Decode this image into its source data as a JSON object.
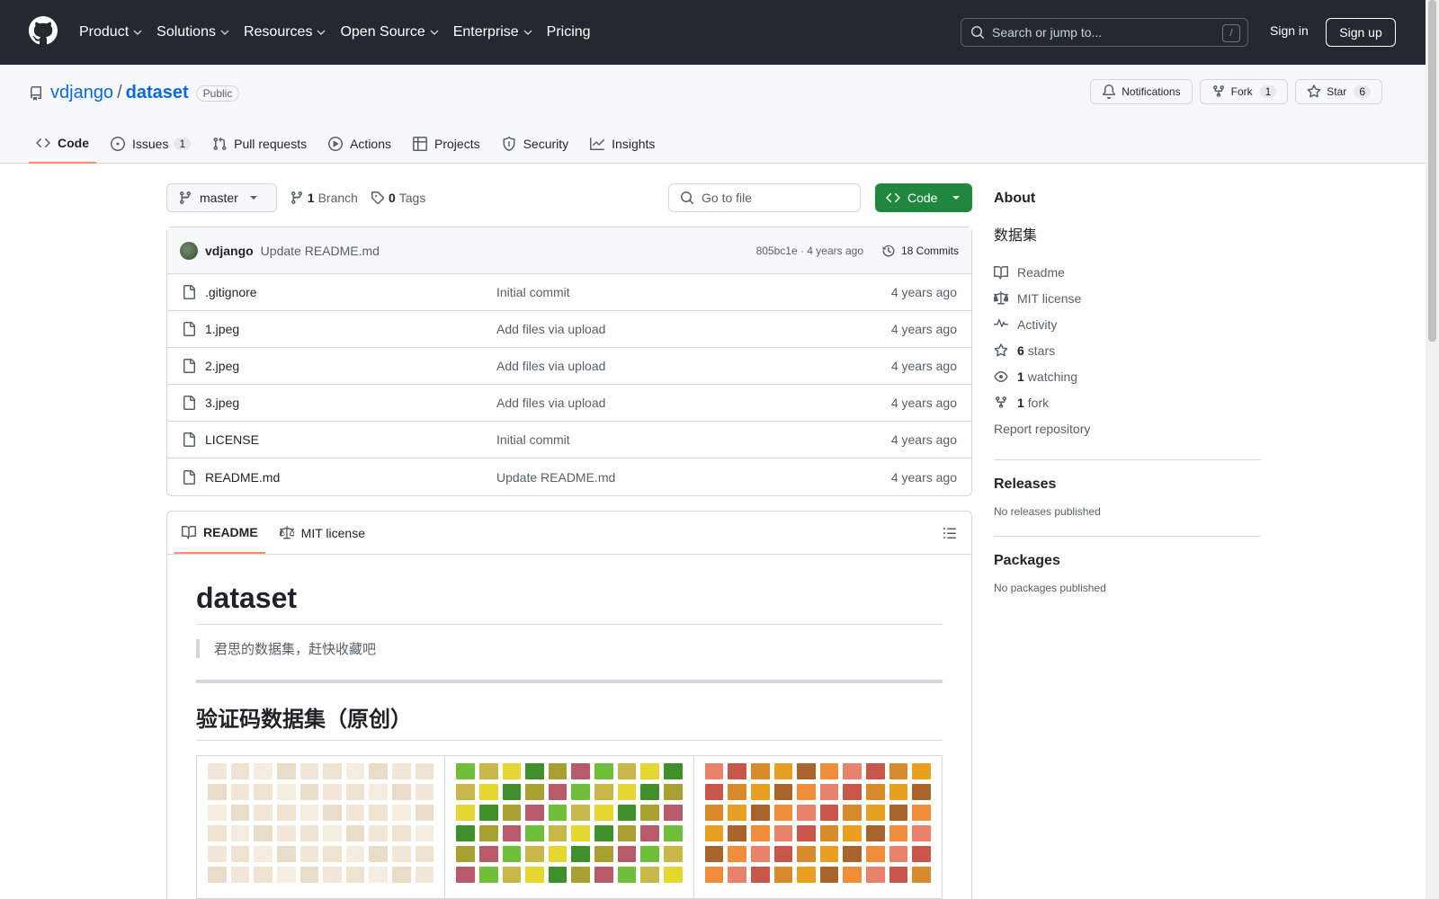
{
  "header": {
    "nav": [
      {
        "label": "Product",
        "has_menu": true
      },
      {
        "label": "Solutions",
        "has_menu": true
      },
      {
        "label": "Resources",
        "has_menu": true
      },
      {
        "label": "Open Source",
        "has_menu": true
      },
      {
        "label": "Enterprise",
        "has_menu": true
      },
      {
        "label": "Pricing",
        "has_menu": false
      }
    ],
    "search_placeholder": "Search or jump to...",
    "search_shortcut": "/",
    "sign_in": "Sign in",
    "sign_up": "Sign up"
  },
  "repo": {
    "owner": "vdjango",
    "separator": "/",
    "name": "dataset",
    "visibility": "Public",
    "notifications_label": "Notifications",
    "fork_label": "Fork",
    "fork_count": "1",
    "star_label": "Star",
    "star_count": "6"
  },
  "tabs": [
    {
      "label": "Code",
      "icon": "code-icon",
      "active": true,
      "count": ""
    },
    {
      "label": "Issues",
      "icon": "issue-icon",
      "active": false,
      "count": "1"
    },
    {
      "label": "Pull requests",
      "icon": "pull-request-icon",
      "active": false,
      "count": ""
    },
    {
      "label": "Actions",
      "icon": "play-icon",
      "active": false,
      "count": ""
    },
    {
      "label": "Projects",
      "icon": "table-icon",
      "active": false,
      "count": ""
    },
    {
      "label": "Security",
      "icon": "shield-icon",
      "active": false,
      "count": ""
    },
    {
      "label": "Insights",
      "icon": "graph-icon",
      "active": false,
      "count": ""
    }
  ],
  "file_nav": {
    "branch": "master",
    "branch_count": "1",
    "branch_label": "Branch",
    "tag_count": "0",
    "tag_label": "Tags",
    "goto_file": "Go to file",
    "code_button": "Code"
  },
  "commit": {
    "author": "vdjango",
    "message": "Update README.md",
    "meta": "805bc1e · 4 years ago",
    "commits_label": "18 Commits"
  },
  "files": [
    {
      "name": ".gitignore",
      "message": "Initial commit",
      "date": "4 years ago"
    },
    {
      "name": "1.jpeg",
      "message": "Add files via upload",
      "date": "4 years ago"
    },
    {
      "name": "2.jpeg",
      "message": "Add files via upload",
      "date": "4 years ago"
    },
    {
      "name": "3.jpeg",
      "message": "Add files via upload",
      "date": "4 years ago"
    },
    {
      "name": "LICENSE",
      "message": "Initial commit",
      "date": "4 years ago"
    },
    {
      "name": "README.md",
      "message": "Update README.md",
      "date": "4 years ago"
    }
  ],
  "readme": {
    "tab_readme": "README",
    "tab_license": "MIT license",
    "h1": "dataset",
    "quote": "君思的数据集，赶快收藏吧",
    "h2": "验证码数据集（原创）",
    "image_palettes": [
      [
        "#f3e6d9",
        "#e9dcc8",
        "#f6ede2",
        "#efe2d0"
      ],
      [
        "#6fbf3a",
        "#c8b84a",
        "#e6d630",
        "#3f8f2a",
        "#a8a030",
        "#b85a6a"
      ],
      [
        "#e8826a",
        "#c8574a",
        "#d98a2a",
        "#e9a020",
        "#a8642a",
        "#f08c3a"
      ]
    ]
  },
  "sidebar": {
    "about_title": "About",
    "description": "数据集",
    "items": [
      {
        "icon": "book-icon",
        "bold": "",
        "label": "Readme"
      },
      {
        "icon": "law-icon",
        "bold": "",
        "label": "MIT license"
      },
      {
        "icon": "pulse-icon",
        "bold": "",
        "label": "Activity"
      },
      {
        "icon": "star-icon",
        "bold": "6",
        "label": "stars"
      },
      {
        "icon": "eye-icon",
        "bold": "1",
        "label": "watching"
      },
      {
        "icon": "fork-icon",
        "bold": "1",
        "label": "fork"
      },
      {
        "icon": "",
        "bold": "",
        "label": "Report repository"
      }
    ],
    "releases_title": "Releases",
    "releases_note": "No releases published",
    "packages_title": "Packages",
    "packages_note": "No packages published"
  },
  "colors": {
    "header_bg": "#24292f",
    "accent_blue": "#0969da",
    "green_button": "#1f883d",
    "tab_underline": "#fd8c73"
  }
}
